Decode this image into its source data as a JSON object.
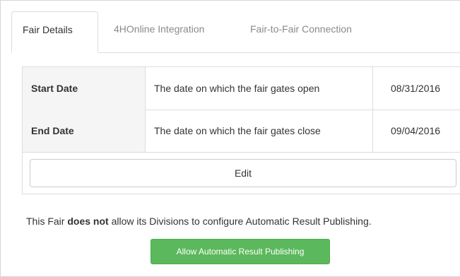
{
  "tabs": [
    {
      "label": "Fair Details",
      "active": true
    },
    {
      "label": "4HOnline Integration",
      "active": false
    },
    {
      "label": "Fair-to-Fair Connection",
      "active": false
    }
  ],
  "dates_table": {
    "rows": [
      {
        "name": "Start Date",
        "description": "The date on which the fair gates open",
        "value": "08/31/2016"
      },
      {
        "name": "End Date",
        "description": "The date on which the fair gates close",
        "value": "09/04/2016"
      }
    ],
    "edit_label": "Edit"
  },
  "publishing": {
    "text_before": "This Fair ",
    "text_emphasis": "does not",
    "text_after": " allow its Divisions to configure Automatic Result Publishing.",
    "button_label": "Allow Automatic Result Publishing",
    "button_color": "#5cb85c"
  }
}
